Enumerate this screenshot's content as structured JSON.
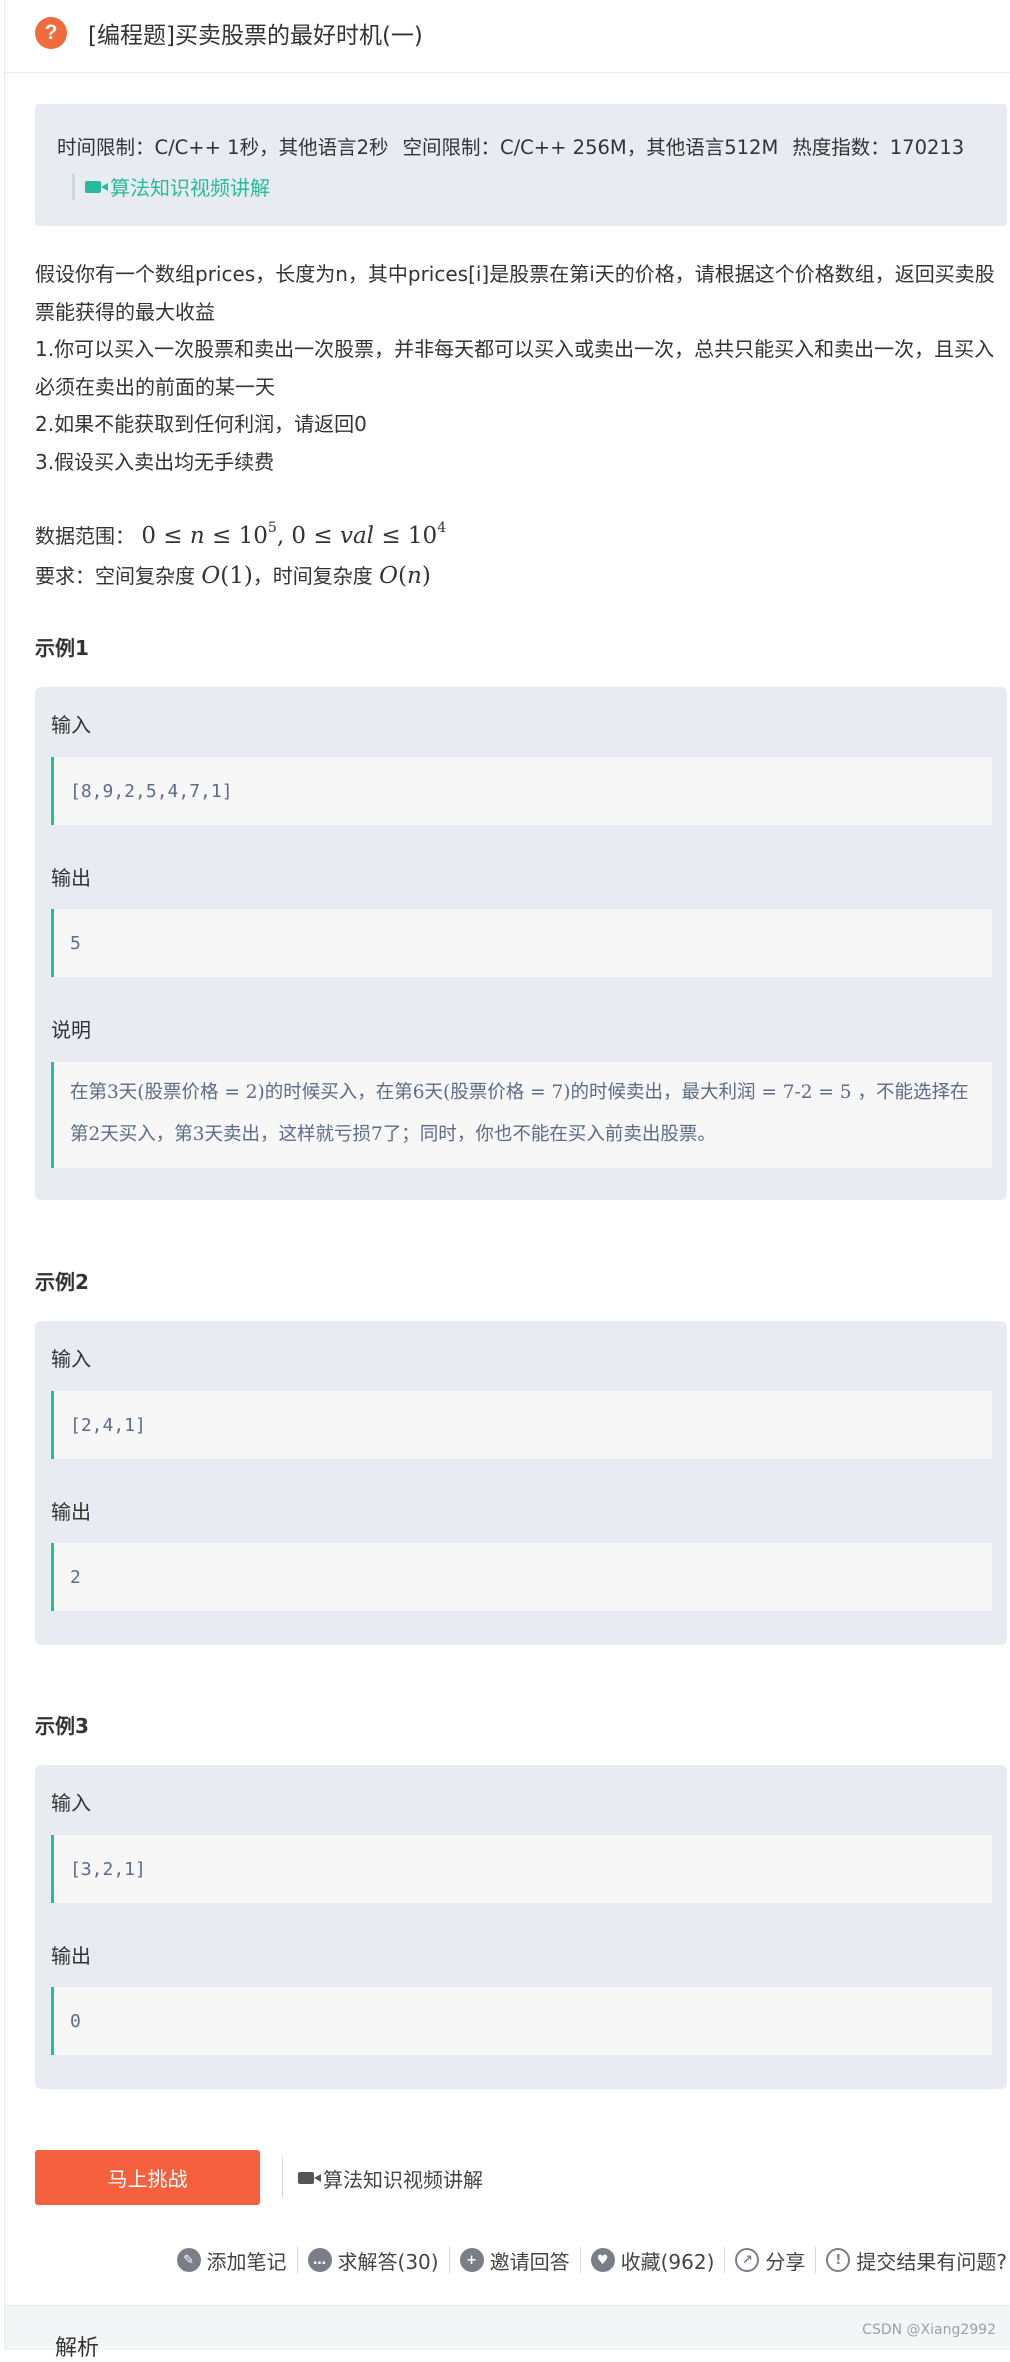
{
  "header": {
    "icon": "question-icon",
    "title": "[编程题]买卖股票的最好时机(一)"
  },
  "limits": {
    "time": "时间限制：C/C++ 1秒，其他语言2秒",
    "space": "空间限制：C/C++ 256M，其他语言512M",
    "heat": "热度指数：170213",
    "video_link": "算法知识视频讲解"
  },
  "description": {
    "line1": "假设你有一个数组prices，长度为n，其中prices[i]是股票在第i天的价格，请根据这个价格数组，返回买卖股票能获得的最大收益",
    "line2": "1.你可以买入一次股票和卖出一次股票，并非每天都可以买入或卖出一次，总共只能买入和卖出一次，且买入必须在卖出的前面的某一天",
    "line3": "2.如果不能获取到任何利润，请返回0",
    "line4": "3.假设买入卖出均无手续费"
  },
  "constraints": {
    "range_label": "数据范围：",
    "require_label": "要求：空间复杂度 ",
    "require_mid": "，时间复杂度 "
  },
  "examples": [
    {
      "title": "示例1",
      "input_label": "输入",
      "input": "[8,9,2,5,4,7,1]",
      "output_label": "输出",
      "output": "5",
      "explain_label": "说明",
      "explain": "在第3天(股票价格 = 2)的时候买入，在第6天(股票价格 = 7)的时候卖出，最大利润 = 7-2 = 5 ，不能选择在第2天买入，第3天卖出，这样就亏损7了；同时，你也不能在买入前卖出股票。"
    },
    {
      "title": "示例2",
      "input_label": "输入",
      "input": "[2,4,1]",
      "output_label": "输出",
      "output": "2"
    },
    {
      "title": "示例3",
      "input_label": "输入",
      "input": "[3,2,1]",
      "output_label": "输出",
      "output": "0"
    }
  ],
  "cta": {
    "challenge": "马上挑战",
    "video": "算法知识视频讲解"
  },
  "actions": {
    "note": "添加笔记",
    "answers": "求解答(30)",
    "invite": "邀请回答",
    "favorite": "收藏(962)",
    "share": "分享",
    "report": "提交结果有问题?"
  },
  "footer": {
    "analysis": "解析",
    "watermark": "CSDN @Xiang2992"
  },
  "colors": {
    "accent_green": "#25bb9b",
    "button_orange": "#f5603f",
    "icon_orange": "#f16c3c",
    "panel_bg": "#e8ecf2"
  }
}
